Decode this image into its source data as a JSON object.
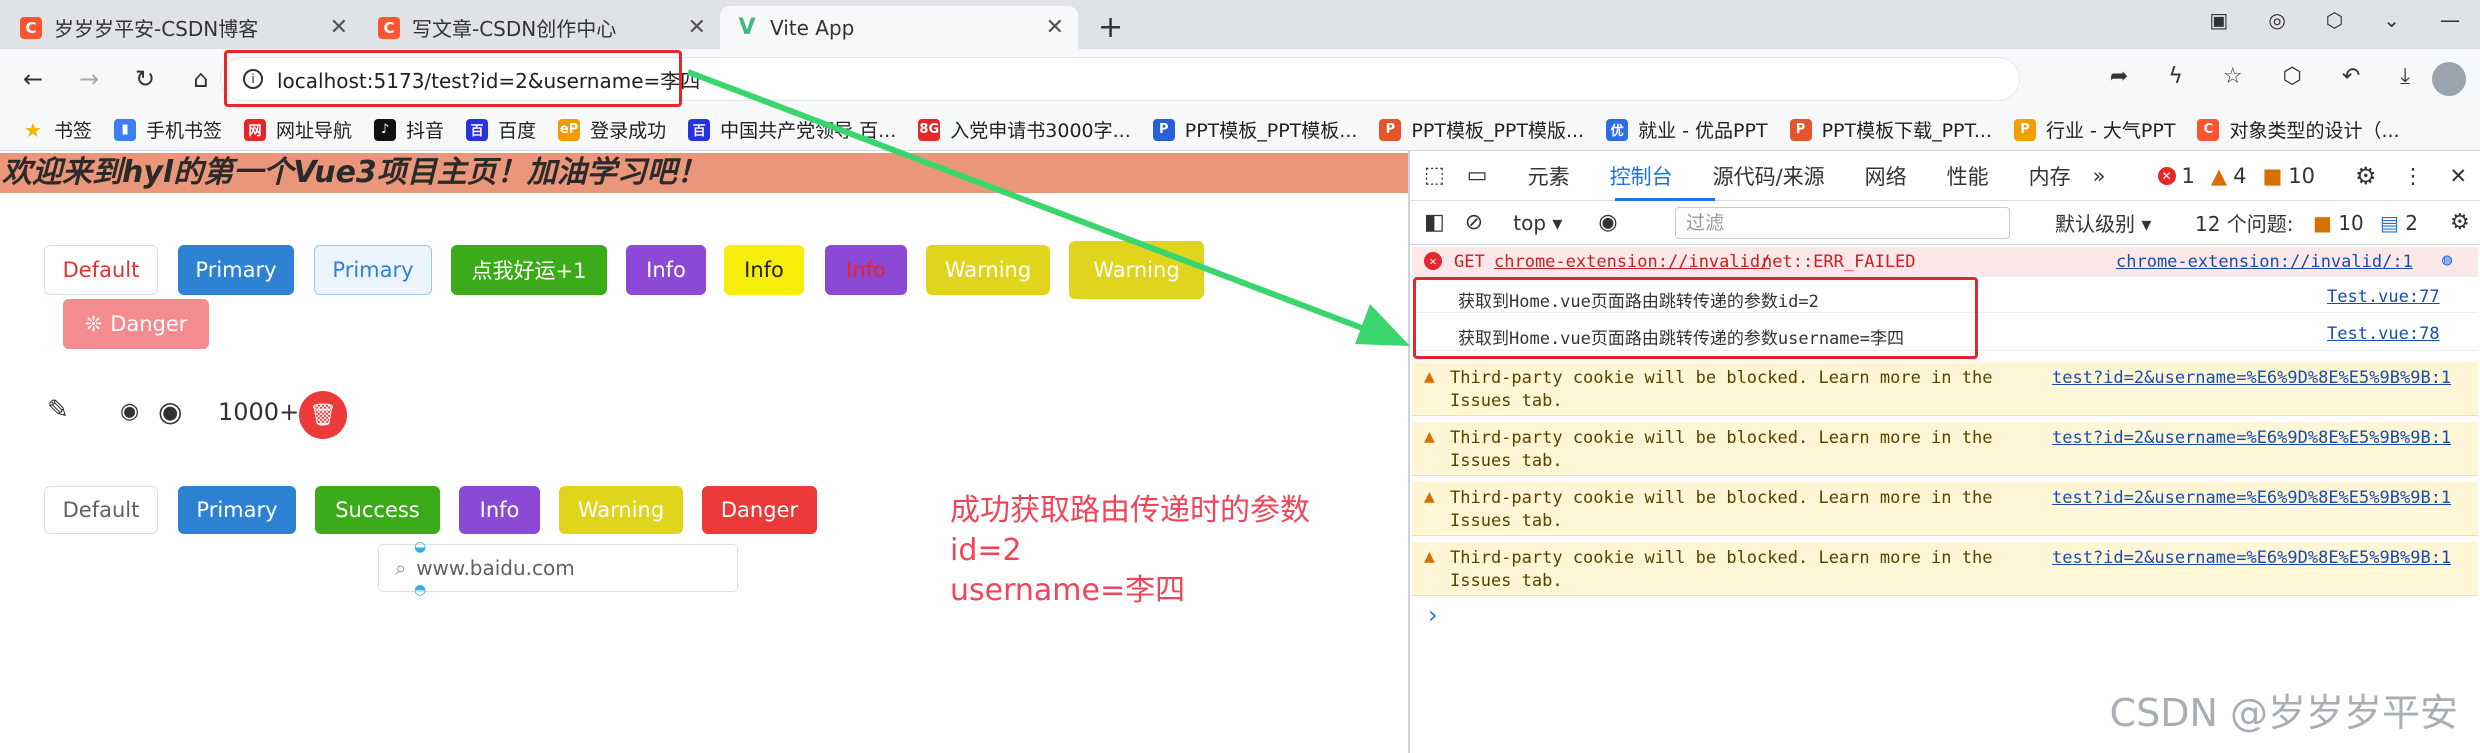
{
  "browser": {
    "tabs": [
      {
        "title": "岁岁岁平安-CSDN博客",
        "icon": "C"
      },
      {
        "title": "写文章-CSDN创作中心",
        "icon": "C"
      },
      {
        "title": "Vite App",
        "icon": "V"
      }
    ],
    "new_tab": "+",
    "url": "localhost:5173/test?id=2&username=李四",
    "bookmarks": [
      {
        "label": "书签",
        "color": "#f5b400",
        "icon": "★"
      },
      {
        "label": "手机书签",
        "color": "#3d7ef5",
        "icon": "▮"
      },
      {
        "label": "网址导航",
        "color": "#e5262b",
        "icon": "网"
      },
      {
        "label": "抖音",
        "color": "#111111",
        "icon": "♪"
      },
      {
        "label": "百度",
        "color": "#2932e1",
        "icon": "百"
      },
      {
        "label": "登录成功",
        "color": "#f59a00",
        "icon": "eP"
      },
      {
        "label": "中国共产党领导 百...",
        "color": "#2932e1",
        "icon": "百"
      },
      {
        "label": "入党申请书3000字...",
        "color": "#e5262b",
        "icon": "8G"
      },
      {
        "label": "PPT模板_PPT模板...",
        "color": "#2b5fd9",
        "icon": "P"
      },
      {
        "label": "PPT模板_PPT模版...",
        "color": "#e6542b",
        "icon": "P"
      },
      {
        "label": "就业 - 优品PPT",
        "color": "#2f6de1",
        "icon": "优"
      },
      {
        "label": "PPT模板下载_PPT...",
        "color": "#e6542b",
        "icon": "P"
      },
      {
        "label": "行业 - 大气PPT",
        "color": "#f0a000",
        "icon": "P"
      },
      {
        "label": "对象类型的设计（...",
        "color": "#fc5531",
        "icon": "C"
      }
    ]
  },
  "page": {
    "banner": "欢迎来到hyl的第一个Vue3项目主页！加油学习吧！",
    "row1": [
      {
        "label": "Default"
      },
      {
        "label": "Primary"
      },
      {
        "label": "Primary"
      },
      {
        "label": "点我好运+1"
      },
      {
        "label": "Info"
      },
      {
        "label": "Info"
      },
      {
        "label": "Info"
      },
      {
        "label": "Warning"
      },
      {
        "label": "Warning"
      },
      {
        "label": "Danger"
      }
    ],
    "badge": "1000+",
    "search_value": "www.baidu.com",
    "row3": [
      {
        "label": "Default"
      },
      {
        "label": "Primary"
      },
      {
        "label": "Success"
      },
      {
        "label": "Info"
      },
      {
        "label": "Warning"
      },
      {
        "label": "Danger"
      }
    ],
    "annotation": [
      "成功获取路由传递时的参数",
      "id=2",
      "username=李四"
    ]
  },
  "devtools": {
    "tabs": [
      "元素",
      "控制台",
      "源代码/来源",
      "网络",
      "性能",
      "内存"
    ],
    "active_tab": "控制台",
    "errors": "1",
    "warnings": "4",
    "issues_count": "10",
    "context": "top",
    "filter_placeholder": "过滤",
    "level": "默认级别",
    "issues_label": "12 个问题:",
    "issues_warn": "10",
    "issues_info": "2",
    "messages": [
      {
        "type": "error",
        "prefix": "GET",
        "link": "chrome-extension://invalid/",
        "text": "net::ERR_FAILED",
        "source": "chrome-extension://invalid/:1"
      },
      {
        "type": "log",
        "text": "获取到Home.vue页面路由跳转传递的参数id=2",
        "source": "Test.vue:77"
      },
      {
        "type": "log",
        "text": "获取到Home.vue页面路由跳转传递的参数username=李四",
        "source": "Test.vue:78"
      },
      {
        "type": "warn",
        "line1": "Third-party cookie will be blocked. Learn more in the",
        "line2": "Issues tab.",
        "source": "test?id=2&username=%E6%9D%8E%E5%9B%9B:1"
      },
      {
        "type": "warn",
        "line1": "Third-party cookie will be blocked. Learn more in the",
        "line2": "Issues tab.",
        "source": "test?id=2&username=%E6%9D%8E%E5%9B%9B:1"
      },
      {
        "type": "warn",
        "line1": "Third-party cookie will be blocked. Learn more in the",
        "line2": "Issues tab.",
        "source": "test?id=2&username=%E6%9D%8E%E5%9B%9B:1"
      },
      {
        "type": "warn",
        "line1": "Third-party cookie will be blocked. Learn more in the",
        "line2": "Issues tab.",
        "source": "test?id=2&username=%E6%9D%8E%E5%9B%9B:1"
      }
    ],
    "prompt": "›"
  },
  "watermark": "CSDN @岁岁岁平安",
  "colors": {
    "accent": "#1a73e8",
    "annotation": "#f0445a",
    "highlight": "#e5262b",
    "arrow": "#3ad66d"
  }
}
